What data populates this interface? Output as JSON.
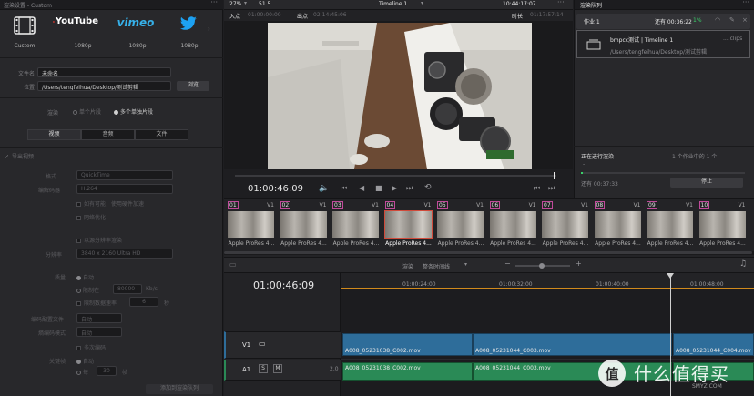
{
  "left_panel": {
    "title": "渲染设置 - Custom",
    "presets": [
      {
        "name": "Custom",
        "sub": "Custom"
      },
      {
        "name": "YouTube",
        "sub": "1080p"
      },
      {
        "name": "vimeo",
        "sub": "1080p"
      },
      {
        "name": "twitter",
        "sub": "1080p"
      }
    ],
    "filename_label": "文件名",
    "filename_value": "未命名",
    "location_label": "位置",
    "location_value": "/Users/tengfeihua/Desktop/测试剪辑",
    "browse_label": "浏览",
    "render_label": "渲染",
    "render_single": "单个片段",
    "render_multi": "多个单独片段",
    "tabs": [
      "视频",
      "音频",
      "文件"
    ],
    "export_video": "导出视频",
    "format_label": "格式",
    "format_value": "QuickTime",
    "codec_label": "编解码器",
    "codec_value": "H.264",
    "hw_accel": "如有可能，使用硬件加速",
    "net_opt": "网络优化",
    "res_label": "分辨率",
    "res_value": "3840 x 2160 Ultra HD",
    "timeline_res": "以源分辨率渲染",
    "quality_label": "质量",
    "quality_auto": "自动",
    "limit_label": "限制在",
    "limit_value": "80000",
    "limit_unit": "Kb/s",
    "frame_limit": "限制数据速率",
    "frame_value": "6",
    "frame_unit": "秒",
    "encode_profile_label": "编码配置文件",
    "encode_profile_value": "自动",
    "entropy_label": "熵编码模式",
    "entropy_value": "自动",
    "multipass": "多次编码",
    "keyframe_label": "关键帧",
    "keyframe_auto": "自动",
    "keyframe_every": "每",
    "keyframe_value": "30",
    "keyframe_unit": "帧",
    "add_queue": "添加到渲染队列"
  },
  "viewer": {
    "zoom": "27%",
    "fps": "51.5",
    "timeline_name": "Timeline 1",
    "timecode_top": "10:44:17:07",
    "in_label": "入点",
    "in_value": "01:00:00:00",
    "out_label": "出点",
    "out_value": "02:14:45:06",
    "duration_label": "时长",
    "duration_value": "01:17:57:14",
    "current_tc": "01:00:46:09"
  },
  "queue": {
    "title": "渲染队列",
    "job_name": "作业 1",
    "job_remaining": "还有 00:36:22",
    "job_percent": "1%",
    "job_title": "bmpcc测试 | Timeline 1",
    "job_path": "/Users/tengfeihua/Desktop/测试剪辑",
    "job_clips": "... clips",
    "status_label": "正在进行渲染",
    "status_count": "1 个作业中的 1 个",
    "status_dash": "-",
    "remaining_label": "还有 00:37:33",
    "stop_button": "停止"
  },
  "clips": [
    {
      "num": "01",
      "track": "V1",
      "label": "Apple ProRes 4...",
      "color": "#c04a9a"
    },
    {
      "num": "02",
      "track": "V1",
      "label": "Apple ProRes 4...",
      "color": "#c04a9a"
    },
    {
      "num": "03",
      "track": "V1",
      "label": "Apple ProRes 4...",
      "color": "#c04a9a"
    },
    {
      "num": "04",
      "track": "V1",
      "label": "Apple ProRes 4...",
      "color": "#c04a9a"
    },
    {
      "num": "05",
      "track": "V1",
      "label": "Apple ProRes 4...",
      "color": "#c04a9a"
    },
    {
      "num": "06",
      "track": "V1",
      "label": "Apple ProRes 4...",
      "color": "#c04a9a"
    },
    {
      "num": "07",
      "track": "V1",
      "label": "Apple ProRes 4...",
      "color": "#c04a9a"
    },
    {
      "num": "08",
      "track": "V1",
      "label": "Apple ProRes 4...",
      "color": "#c04a9a"
    },
    {
      "num": "09",
      "track": "V1",
      "label": "Apple ProRes 4...",
      "color": "#c04a9a"
    },
    {
      "num": "10",
      "track": "V1",
      "label": "Apple ProRes 4...",
      "color": "#c04a9a"
    }
  ],
  "timeline": {
    "render_label": "渲染",
    "range_value": "整条时间线",
    "current_tc": "01:00:46:09",
    "ruler": [
      "01:00:24:00",
      "01:00:32:00",
      "01:00:40:00",
      "01:00:48:00"
    ],
    "v1_label": "V1",
    "a1_label": "A1",
    "a1_s": "S",
    "a1_m": "M",
    "a1_level": "2.0",
    "video_clips": [
      "A008_05231038_C002.mov",
      "A008_05231044_C003.mov",
      "A008_05231044_C004.mov"
    ],
    "audio_clips": [
      "A008_05231038_C002.mov",
      "A008_05231044_C003.mov"
    ]
  },
  "watermark": {
    "brand": "什么值得买",
    "site": "SMYZ.COM"
  }
}
